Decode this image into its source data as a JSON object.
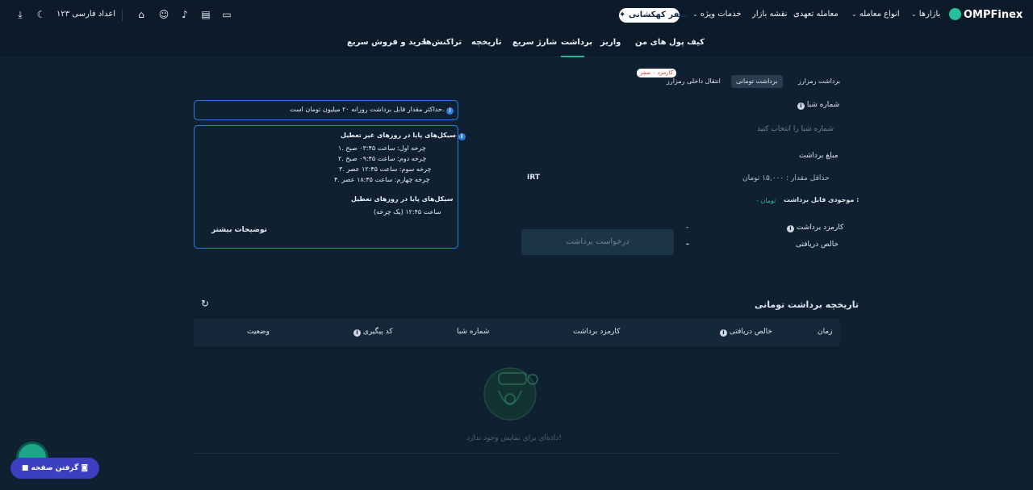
{
  "header": {
    "logo_text": "OMPFinex",
    "nav": [
      "بازارها",
      "انواع معامله",
      "معامله تعهدی",
      "نقشه بازار",
      "خدمات ویژه"
    ],
    "promo_label": "سفر کهکشانی",
    "digits_label": "اعداد فارسی ۱۲۳"
  },
  "subnav": {
    "tabs": [
      "کیف پول های من",
      "واریز",
      "برداشت",
      "شارژ سریع",
      "تاریخچه",
      "تراکنش‌ها",
      "خرید و فروش سریع"
    ],
    "active": "برداشت"
  },
  "withdraw": {
    "tabs": [
      "برداشت رمزارز",
      "برداشت تومانی",
      "انتقال داخلی رمزارز"
    ],
    "active_tab": "برداشت تومانی",
    "fee_badge": "کارمزد ۰ صفر",
    "sheba_label": "شماره شبا",
    "sheba_placeholder": "شماره شبا را انتخاب کنید",
    "amount_label": "مبلغ برداشت",
    "amount_placeholder": "حداقل مقدار : ۱۵,۰۰۰ تومان",
    "currency": "IRT",
    "balance_label": "موجودی قابل برداشت :",
    "balance_value": "- تومان",
    "fee_label": "کارمزد برداشت",
    "fee_value": "-",
    "net_label": "خالص دریافتی",
    "net_value": "-",
    "submit_label": "درخواست برداشت"
  },
  "info": {
    "limit_text": "حداکثر مقدار قابل برداشت روزانه ۲۰ میلیون تومان است.",
    "cycles_title": "سیکل‌های پایا در روزهای غیر تعطیل",
    "cycles": [
      "۱. چرخه اول: ساعت ۰۳:۴۵ صبح",
      "۲. چرخه دوم: ساعت ۰۹:۴۵ صبح",
      "۳. چرخه سوم: ساعت ۱۲:۴۵ عصر",
      "۴. چرخه چهارم: ساعت ۱۸:۴۵ عصر"
    ],
    "holiday_title": "سیکل‌های پایا در روزهای تعطیل",
    "holiday_text": "ساعت ۱۲:۴۵ (یک چرخه)",
    "more_link": "توضیحات بیشتر"
  },
  "history": {
    "title": "تاریخچه برداشت تومانی",
    "columns": [
      "زمان",
      "خالص دریافتی",
      "کارمزد برداشت",
      "شماره شبا",
      "کد پیگیری",
      "وضعیت"
    ],
    "empty_text": "داده‌ای برای نمایش وجود ندارد!"
  },
  "tour_button": "گرفتن صفحه",
  "colors": {
    "accent": "#2fb3a0",
    "info_blue": "#2f7de1",
    "bg": "#0f2131",
    "header": "#0c1b29"
  }
}
